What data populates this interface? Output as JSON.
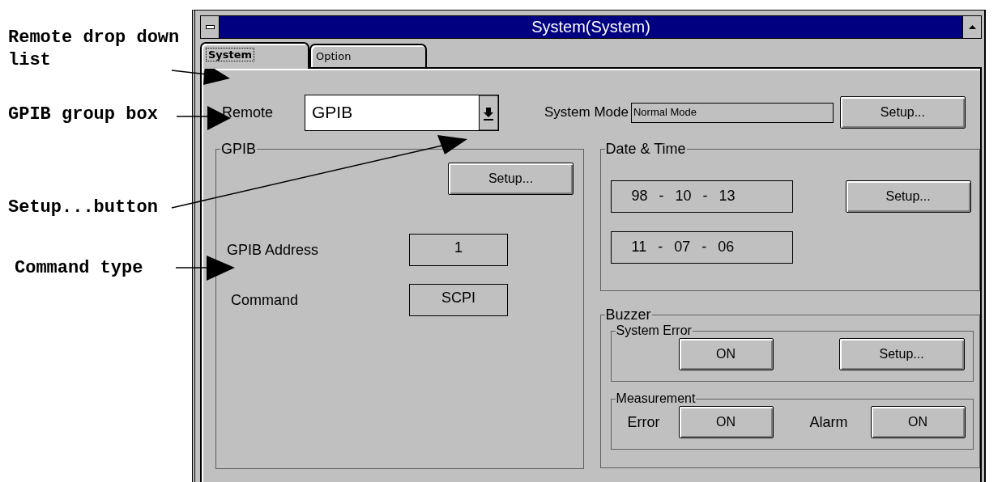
{
  "annotations": [
    {
      "text": "Remote drop down list"
    },
    {
      "text": "GPIB group box"
    },
    {
      "text": "Setup...button"
    },
    {
      "text": "Command type"
    }
  ],
  "window": {
    "title": "System(System)"
  },
  "tabs": [
    {
      "label": "System",
      "selected": true
    },
    {
      "label": "Option",
      "selected": false
    }
  ],
  "remote": {
    "label": "Remote",
    "value": "GPIB"
  },
  "system_mode": {
    "label": "System Mode",
    "value": "Normal Mode",
    "button": "Setup..."
  },
  "gpib": {
    "title": "GPIB",
    "button": "Setup...",
    "address_label": "GPIB Address",
    "address": "1",
    "command_label": "Command",
    "command": "SCPI"
  },
  "date_time": {
    "title": "Date & Time",
    "date": "98 - 10 - 13",
    "time": "11 - 07 - 06",
    "button": "Setup..."
  },
  "buzzer": {
    "title": "Buzzer",
    "system_error": {
      "title": "System Error",
      "button": "ON",
      "setup": "Setup..."
    },
    "measurement": {
      "title": "Measurement",
      "error_label": "Error",
      "error_button": "ON",
      "alarm_label": "Alarm",
      "alarm_button": "ON"
    }
  }
}
